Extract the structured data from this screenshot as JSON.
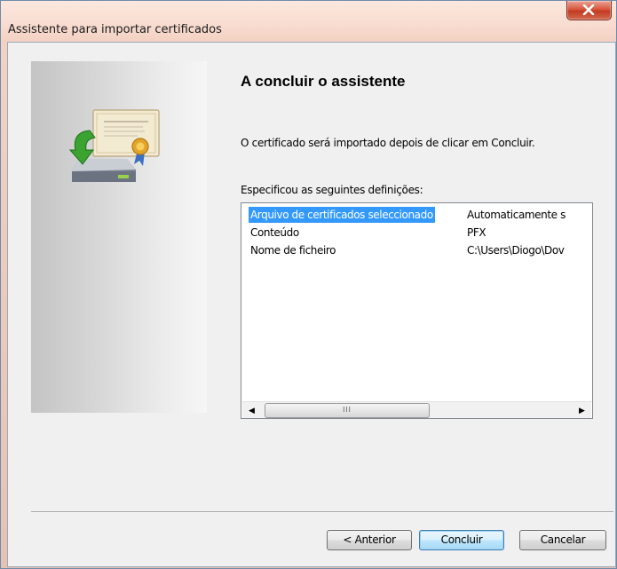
{
  "window": {
    "title": "Assistente para importar certificados"
  },
  "page": {
    "heading": "A concluir o assistente",
    "description": "O certificado será importado depois de clicar em Concluir.",
    "specs_label": "Especificou as seguintes definições:"
  },
  "settings": {
    "rows": [
      {
        "name": "Arquivo de certificados seleccionado",
        "value": "Automaticamente s",
        "selected": true
      },
      {
        "name": "Conteúdo",
        "value": "PFX",
        "selected": false
      },
      {
        "name": "Nome de ficheiro",
        "value": "C:\\Users\\Diogo\\Dov",
        "selected": false
      }
    ],
    "scroll_thumb_grip": "III"
  },
  "buttons": {
    "back": "< Anterior",
    "finish": "Concluir",
    "cancel": "Cancelar"
  },
  "icons": {
    "close": "close-icon",
    "wizard": "certificate-import-icon",
    "scroll_left": "scroll-left-arrow-icon",
    "scroll_right": "scroll-right-arrow-icon"
  },
  "colors": {
    "selection": "#3399ff",
    "close_button": "#c23a21"
  }
}
